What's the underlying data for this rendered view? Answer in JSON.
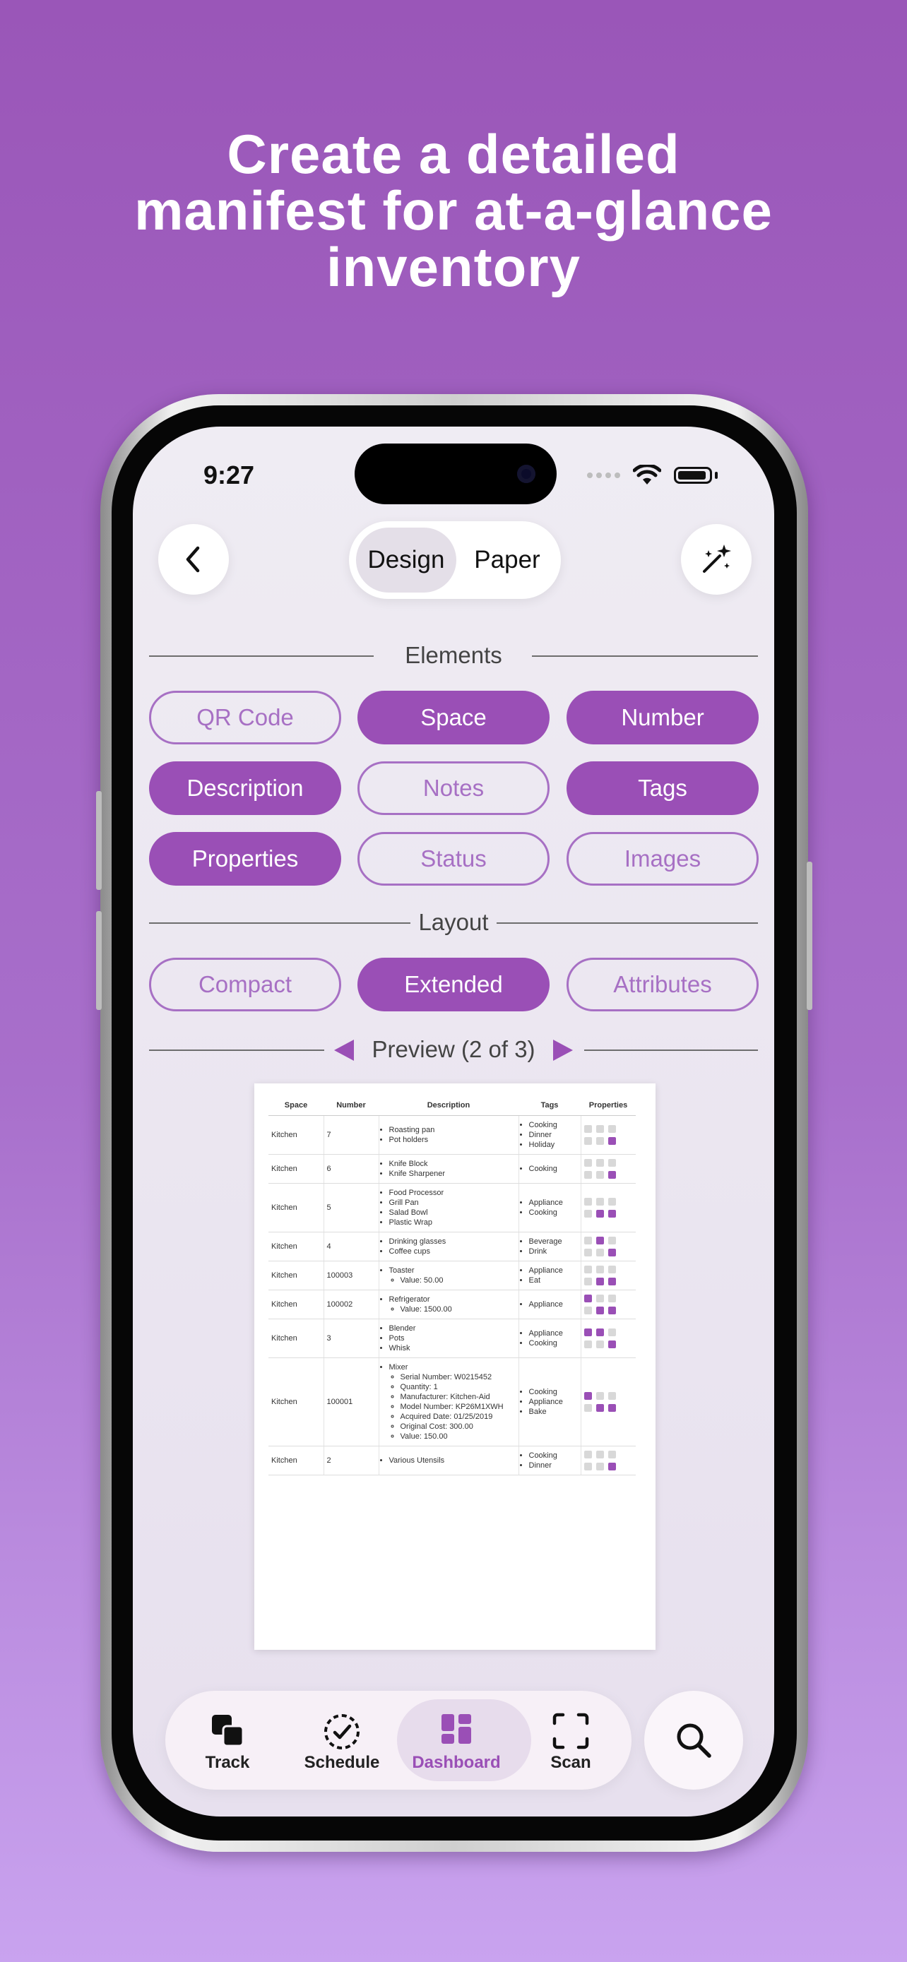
{
  "headline": {
    "line1": "Create a detailed",
    "line2": "manifest for at-a-glance",
    "line3": "inventory"
  },
  "status_bar": {
    "time": "9:27"
  },
  "top_bar": {
    "back_icon": "chevron-left-icon",
    "magic_icon": "magic-wand-icon",
    "segments": [
      "Design",
      "Paper"
    ],
    "selected": "Design"
  },
  "elements": {
    "title": "Elements",
    "items": [
      {
        "label": "QR Code",
        "selected": false
      },
      {
        "label": "Space",
        "selected": true
      },
      {
        "label": "Number",
        "selected": true
      },
      {
        "label": "Description",
        "selected": true
      },
      {
        "label": "Notes",
        "selected": false
      },
      {
        "label": "Tags",
        "selected": true
      },
      {
        "label": "Properties",
        "selected": true
      },
      {
        "label": "Status",
        "selected": false
      },
      {
        "label": "Images",
        "selected": false
      }
    ]
  },
  "layout": {
    "title": "Layout",
    "items": [
      {
        "label": "Compact",
        "selected": false
      },
      {
        "label": "Extended",
        "selected": true
      },
      {
        "label": "Attributes",
        "selected": false
      }
    ]
  },
  "preview": {
    "title": "Preview (2 of 3)"
  },
  "manifest": {
    "headers": [
      "Space",
      "Number",
      "Description",
      "Tags",
      "Properties"
    ],
    "rows": [
      {
        "space": "Kitchen",
        "number": "7",
        "description": [
          "Roasting pan",
          "Pot holders"
        ],
        "tags": [
          "Cooking",
          "Dinner",
          "Holiday"
        ],
        "props": [
          0,
          0,
          0,
          0,
          0,
          1
        ]
      },
      {
        "space": "Kitchen",
        "number": "6",
        "description": [
          "Knife Block",
          "Knife Sharpener"
        ],
        "tags": [
          "Cooking"
        ],
        "props": [
          0,
          0,
          0,
          0,
          0,
          1
        ]
      },
      {
        "space": "Kitchen",
        "number": "5",
        "description": [
          "Food Processor",
          "Grill Pan",
          "Salad Bowl",
          "Plastic Wrap"
        ],
        "tags": [
          "Appliance",
          "Cooking"
        ],
        "props": [
          0,
          0,
          0,
          0,
          1,
          1
        ]
      },
      {
        "space": "Kitchen",
        "number": "4",
        "description": [
          "Drinking glasses",
          "Coffee cups"
        ],
        "tags": [
          "Beverage",
          "Drink"
        ],
        "props": [
          0,
          1,
          0,
          0,
          0,
          1
        ]
      },
      {
        "space": "Kitchen",
        "number": "100003",
        "description": [
          "Toaster"
        ],
        "details": [
          "Value: 50.00"
        ],
        "tags": [
          "Appliance",
          "Eat"
        ],
        "props": [
          0,
          0,
          0,
          0,
          1,
          1
        ]
      },
      {
        "space": "Kitchen",
        "number": "100002",
        "description": [
          "Refrigerator"
        ],
        "details": [
          "Value: 1500.00"
        ],
        "tags": [
          "Appliance"
        ],
        "props": [
          1,
          0,
          0,
          0,
          1,
          1
        ]
      },
      {
        "space": "Kitchen",
        "number": "3",
        "description": [
          "Blender",
          "Pots",
          "Whisk"
        ],
        "tags": [
          "Appliance",
          "Cooking"
        ],
        "props": [
          1,
          1,
          0,
          0,
          0,
          1
        ]
      },
      {
        "space": "Kitchen",
        "number": "100001",
        "description": [
          "Mixer"
        ],
        "details": [
          "Serial Number: W0215452",
          "Quantity: 1",
          "Manufacturer: Kitchen-Aid",
          "Model Number: KP26M1XWH",
          "Acquired Date: 01/25/2019",
          "Original Cost: 300.00",
          "Value: 150.00"
        ],
        "tags": [
          "Cooking",
          "Appliance",
          "Bake"
        ],
        "props": [
          1,
          0,
          0,
          0,
          1,
          1
        ]
      },
      {
        "space": "Kitchen",
        "number": "2",
        "description": [
          "Various Utensils"
        ],
        "tags": [
          "Cooking",
          "Dinner"
        ],
        "props": [
          0,
          0,
          0,
          0,
          0,
          1
        ]
      }
    ]
  },
  "tab_bar": {
    "tabs": [
      {
        "label": "Track",
        "icon": "track-icon"
      },
      {
        "label": "Schedule",
        "icon": "schedule-icon"
      },
      {
        "label": "Dashboard",
        "icon": "dashboard-icon"
      },
      {
        "label": "Scan",
        "icon": "scan-icon"
      }
    ],
    "active": "Dashboard",
    "search_icon": "search-icon"
  },
  "colors": {
    "accent": "#9a4fb6",
    "background_top": "#9a56b8",
    "background_bottom": "#c9a3ef"
  }
}
